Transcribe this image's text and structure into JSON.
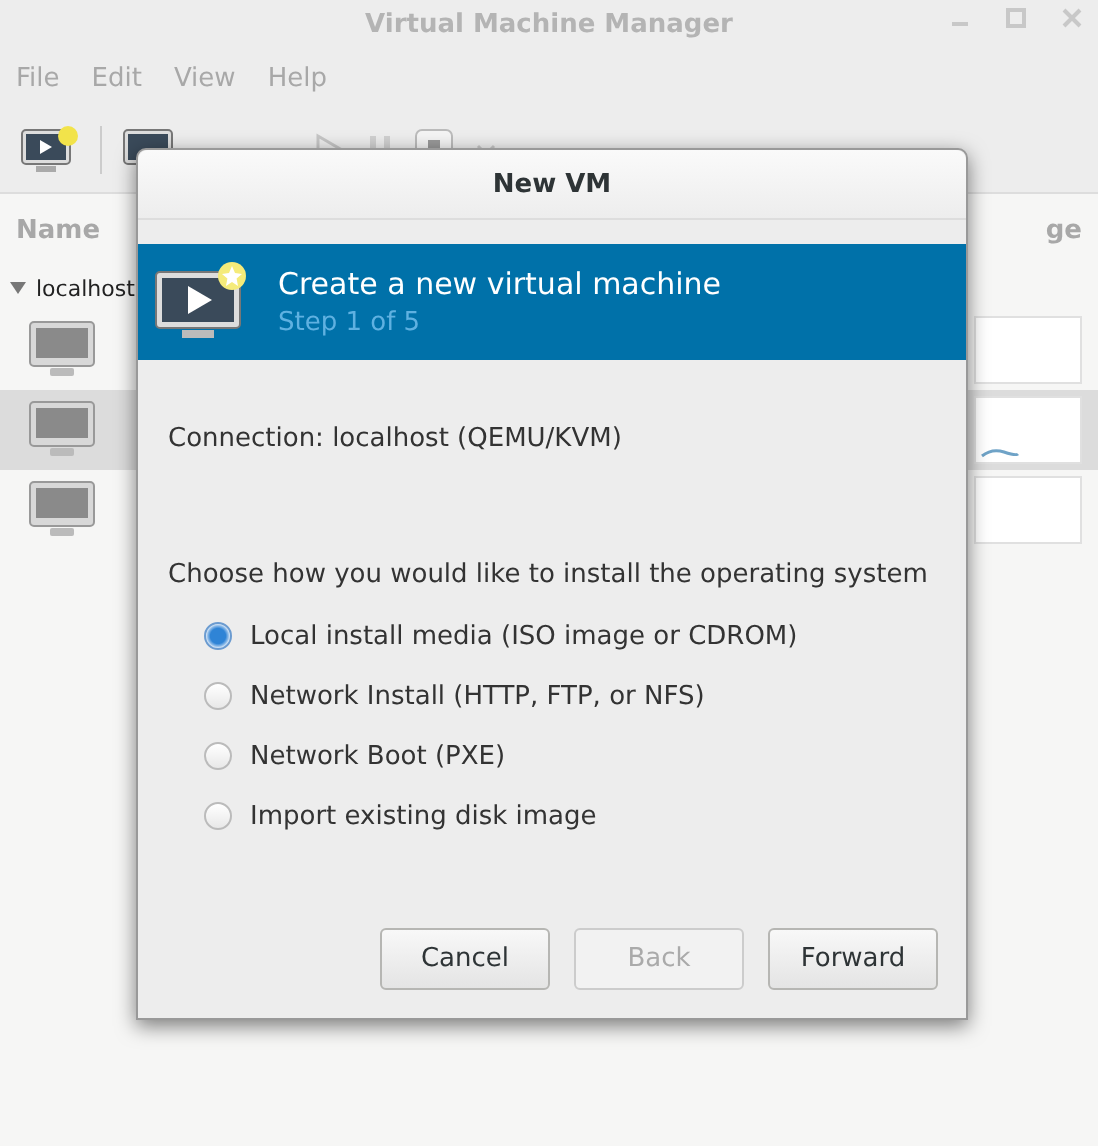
{
  "window": {
    "title": "Virtual Machine Manager"
  },
  "menu": [
    "File",
    "Edit",
    "View",
    "Help"
  ],
  "list": {
    "column_1": "Name",
    "column_2": "ge",
    "host": {
      "name": "localhost",
      "expanded": true
    },
    "vms": [
      {
        "selected": false
      },
      {
        "selected": true
      },
      {
        "selected": false
      }
    ]
  },
  "dialog": {
    "title": "New VM",
    "banner_title": "Create a new virtual machine",
    "banner_step": "Step 1 of 5",
    "connection": "Connection:  localhost (QEMU/KVM)",
    "prompt": "Choose how you would like to install the operating system",
    "options": [
      {
        "label": "Local install media (ISO image or CDROM)",
        "selected": true
      },
      {
        "label": "Network Install (HTTP, FTP, or NFS)",
        "selected": false
      },
      {
        "label": "Network Boot (PXE)",
        "selected": false
      },
      {
        "label": "Import existing disk image",
        "selected": false
      }
    ],
    "buttons": [
      {
        "label": "Cancel",
        "disabled": false
      },
      {
        "label": "Back",
        "disabled": true
      },
      {
        "label": "Forward",
        "disabled": false
      }
    ]
  }
}
